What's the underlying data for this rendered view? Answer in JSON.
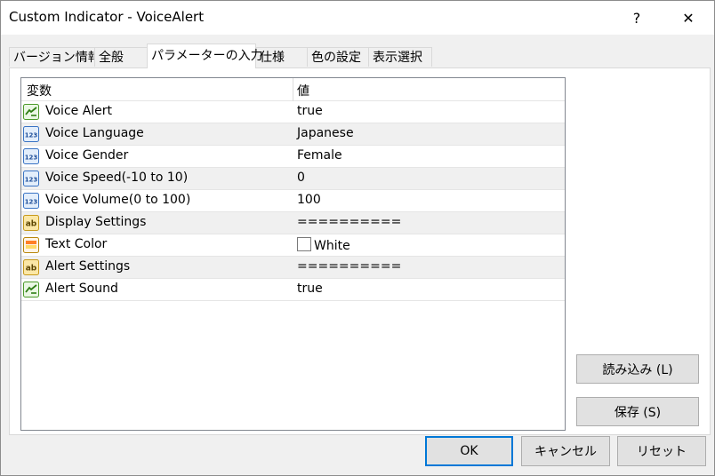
{
  "window": {
    "title": "Custom Indicator - VoiceAlert",
    "help": "?",
    "close": "✕"
  },
  "tabs": [
    {
      "label": "バージョン情報"
    },
    {
      "label": "全般"
    },
    {
      "label": "パラメーターの入力",
      "active": true
    },
    {
      "label": "仕様"
    },
    {
      "label": "色の設定"
    },
    {
      "label": "表示選択"
    }
  ],
  "grid": {
    "col_variable": "変数",
    "col_value": "値",
    "rows": [
      {
        "icon": "bool-icon",
        "name": "Voice Alert",
        "value": "true"
      },
      {
        "icon": "number-icon",
        "name": "Voice Language",
        "value": "Japanese"
      },
      {
        "icon": "number-icon",
        "name": "Voice Gender",
        "value": "Female"
      },
      {
        "icon": "number-icon",
        "name": "Voice Speed(-10 to 10)",
        "value": "0"
      },
      {
        "icon": "number-icon",
        "name": "Voice Volume(0 to 100)",
        "value": "100"
      },
      {
        "icon": "string-icon",
        "name": "Display Settings",
        "value": "=========="
      },
      {
        "icon": "color-icon",
        "name": "Text Color",
        "value": "White",
        "swatch": "#ffffff"
      },
      {
        "icon": "string-icon",
        "name": "Alert Settings",
        "value": "=========="
      },
      {
        "icon": "bool-icon",
        "name": "Alert Sound",
        "value": "true"
      }
    ]
  },
  "buttons": {
    "load": "読み込み (L)",
    "save": "保存 (S)",
    "ok": "OK",
    "cancel": "キャンセル",
    "reset": "リセット"
  },
  "colors": {
    "accent": "#0078d7"
  }
}
